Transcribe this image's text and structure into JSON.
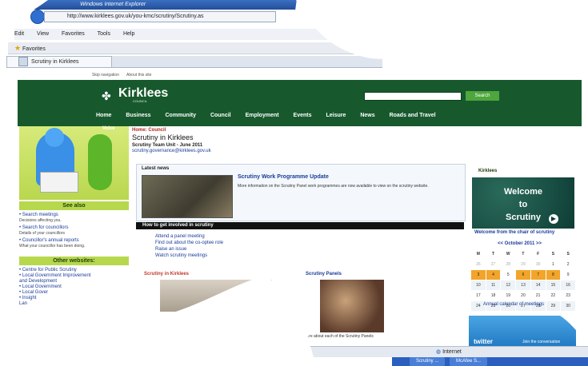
{
  "browser": {
    "title": "Windows Internet Explorer",
    "address": "http://www.kirklees.gov.uk/you-kmc/scrutiny/Scrutiny.as",
    "menu": [
      "Edit",
      "View",
      "Favorites",
      "Tools",
      "Help"
    ],
    "favorites_label": "Favorites",
    "tab_label": "Scrutiny in Kirklees",
    "status_zone": "Internet",
    "taskbar": [
      "Scrutiny ...",
      "McAfee S..."
    ]
  },
  "site": {
    "utility": [
      "Skip navigation",
      "About this site"
    ],
    "logo": "Kirklees",
    "logo_sub": "COUNCIL",
    "search_button": "Search",
    "nav": [
      "Home",
      "Business",
      "Community",
      "Council",
      "Employment",
      "Events",
      "Leisure",
      "News",
      "Roads and Travel"
    ]
  },
  "left": {
    "hero_tag": "Voice",
    "see_also_heading": "See also",
    "see_also": [
      {
        "link": "• Search meetings",
        "desc": "Decisions affecting you."
      },
      {
        "link": "• Search for councillors",
        "desc": "Details of your councillors"
      },
      {
        "link": "• Councillor's annual reports",
        "desc": "What your councillor has been doing."
      }
    ],
    "other_heading": "Other websites:",
    "other": [
      "• Centre for Public Scrutiny",
      "• Local Government Improvement",
      "  and Development",
      "• Local Government",
      "• Local Gover",
      "• Insight",
      "  Lan"
    ]
  },
  "main": {
    "breadcrumb": "Home: Council",
    "title": "Scrutiny in Kirklees",
    "team": "Scrutiny Team Unit - June 2011",
    "email": "scrutiny.governance@kirklees.gov.uk",
    "latest_news": "Latest news",
    "news_link": "Scrutiny Work Programme Update",
    "news_text": "More information on the Scrutiny Panel work programmes are now available to view on the scrutiny website.",
    "how_heading": "How to get involved in scrutiny",
    "how_links": [
      "Attend a panel meeting",
      "Find out about the co-optee role",
      "Raise an issue",
      "Watch scrutiny meetings"
    ],
    "sub1": "Scrutiny in Kirklees",
    "sub2": "Scrutiny Panels",
    "sub2_text": "...re about each of the Scrutiny Panels"
  },
  "right": {
    "kirklees_small": "Kirklees",
    "welcome_lines": [
      "Welcome",
      "to",
      "Scrutiny"
    ],
    "welcome_caption": "Welcome from the chair of scrutiny",
    "calendar_heading": "<< October 2011 >>",
    "calendar_days": [
      "M",
      "T",
      "W",
      "T",
      "F",
      "S",
      "S"
    ],
    "calendar_rows": [
      [
        "26",
        "27",
        "28",
        "29",
        "30",
        "1",
        "2"
      ],
      [
        "3",
        "4",
        "5",
        "6",
        "7",
        "8",
        "9"
      ],
      [
        "10",
        "11",
        "12",
        "13",
        "14",
        "15",
        "16"
      ],
      [
        "17",
        "18",
        "19",
        "20",
        "21",
        "22",
        "23"
      ],
      [
        "24",
        "25",
        "26",
        "27",
        "28",
        "29",
        "30"
      ]
    ],
    "calendar_link": "Annual calendar of meetings",
    "twitter_label": "twitter",
    "twitter_join": "Join the conversation"
  }
}
